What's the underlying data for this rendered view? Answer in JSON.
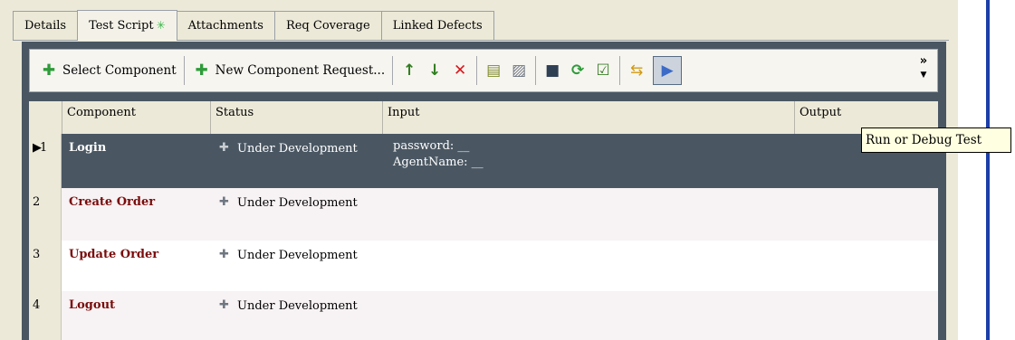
{
  "tabs": [
    {
      "label": "Details",
      "active": false
    },
    {
      "label": "Test Script",
      "active": true,
      "marker": "✳"
    },
    {
      "label": "Attachments",
      "active": false
    },
    {
      "label": "Req Coverage",
      "active": false
    },
    {
      "label": "Linked Defects",
      "active": false
    }
  ],
  "toolbar": {
    "select_component": "Select Component",
    "new_component_request": "New Component Request...",
    "icons": {
      "move_up": "↑",
      "move_down": "↓",
      "delete": "✕",
      "expand_all": "▤",
      "collapse_all": "▨",
      "save": "■",
      "refresh": "⟳",
      "validate": "☑",
      "parameters": "⇆",
      "run": "▶"
    },
    "more": "»"
  },
  "grid": {
    "columns": [
      "Component",
      "Status",
      "Input",
      "Output"
    ],
    "rows": [
      {
        "num": "1",
        "component": "Login",
        "status": "Under Development",
        "input_lines": [
          "password: __",
          "AgentName: __"
        ],
        "selected": true
      },
      {
        "num": "2",
        "component": "Create Order",
        "status": "Under Development",
        "input_lines": [],
        "selected": false
      },
      {
        "num": "3",
        "component": "Update Order",
        "status": "Under Development",
        "input_lines": [],
        "selected": false
      },
      {
        "num": "4",
        "component": "Logout",
        "status": "Under Development",
        "input_lines": [],
        "selected": false
      }
    ]
  },
  "tooltip": "Run or Debug Test",
  "colors": {
    "selected_row": "#4a5763",
    "component_text": "#7a0c0c",
    "accent_blue": "#1c3ea7"
  }
}
